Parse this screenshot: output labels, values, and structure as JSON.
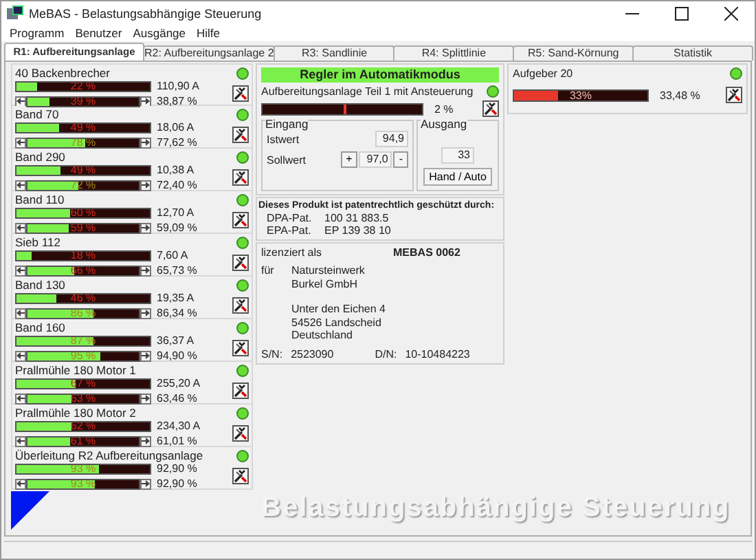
{
  "window": {
    "title": "MeBAS - Belastungsabhängige Steuerung"
  },
  "menu": [
    "Programm",
    "Benutzer",
    "Ausgänge",
    "Hilfe"
  ],
  "tabs": [
    {
      "label": "R1: Aufbereitungsanlage",
      "selected": true
    },
    {
      "label": "R2: Aufbereitungsanlage 2",
      "selected": false
    },
    {
      "label": "R3: Sandlinie",
      "selected": false
    },
    {
      "label": "R4: Splittlinie",
      "selected": false
    },
    {
      "label": "R5: Sand-Körnung",
      "selected": false
    },
    {
      "label": "Statistik",
      "selected": false
    }
  ],
  "drives": [
    {
      "name": "40 Backenbrecher",
      "color": "#66dd33",
      "load": {
        "label": "22 %",
        "level": 0.15,
        "reading": "110,90 A"
      },
      "setpoint": {
        "label": "39 %",
        "level": 0.2,
        "reading": "38,87 %"
      }
    },
    {
      "name": "Band 70",
      "color": "#66dd33",
      "load": {
        "label": "49 %",
        "level": 0.32,
        "reading": "18,06 A"
      },
      "setpoint": {
        "label": "78 %",
        "level": 0.52,
        "reading": "77,62 %"
      }
    },
    {
      "name": "Band 290",
      "color": "#66dd33",
      "load": {
        "label": "49 %",
        "level": 0.33,
        "reading": "10,38 A"
      },
      "setpoint": {
        "label": "72 %",
        "level": 0.46,
        "reading": "72,40 %"
      }
    },
    {
      "name": "Band 110",
      "color": "#66dd33",
      "load": {
        "label": "60 %",
        "level": 0.4,
        "reading": "12,70 A"
      },
      "setpoint": {
        "label": "59 %",
        "level": 0.37,
        "reading": "59,09 %"
      }
    },
    {
      "name": "Sieb 112",
      "color": "#66dd33",
      "load": {
        "label": "18 %",
        "level": 0.11,
        "reading": "7,60 A"
      },
      "setpoint": {
        "label": "66 %",
        "level": 0.42,
        "reading": "65,73 %"
      }
    },
    {
      "name": "Band 130",
      "color": "#66dd33",
      "load": {
        "label": "46 %",
        "level": 0.3,
        "reading": "19,35 A"
      },
      "setpoint": {
        "label": "86 %",
        "level": 0.59,
        "reading": "86,34 %"
      }
    },
    {
      "name": "Band 160",
      "color": "#66dd33",
      "load": {
        "label": "87 %",
        "level": 0.58,
        "reading": "36,37 A"
      },
      "setpoint": {
        "label": "95 %",
        "level": 0.66,
        "reading": "94,90 %"
      }
    },
    {
      "name": "Prallmühle 180 Motor 1",
      "color": "#66dd33",
      "load": {
        "label": "67 %",
        "level": 0.44,
        "reading": "255,20 A"
      },
      "setpoint": {
        "label": "63 %",
        "level": 0.4,
        "reading": "63,46 %"
      }
    },
    {
      "name": "Prallmühle 180 Motor 2",
      "color": "#66dd33",
      "load": {
        "label": "62 %",
        "level": 0.41,
        "reading": "234,30 A"
      },
      "setpoint": {
        "label": "61 %",
        "level": 0.38,
        "reading": "61,01 %"
      }
    },
    {
      "name": "Überleitung R2 Aufbereitungsanlage",
      "color": "#66dd33",
      "load": {
        "label": "93 %",
        "level": 0.62,
        "reading": "92,90 %"
      },
      "setpoint": {
        "label": "93 %",
        "level": 0.6,
        "reading": "92,90 %"
      }
    }
  ],
  "controller": {
    "mode_banner": "Regler im Automatikmodus",
    "name": "Aufbereitungsanlage Teil 1 mit Ansteuerung",
    "color": "#66dd33",
    "output": {
      "level": 0.51,
      "reading": "2 %"
    },
    "input": {
      "legend": "Eingang",
      "actual_label": "Istwert",
      "actual_value": "94,9",
      "setpoint_label": "Sollwert",
      "increase": "+",
      "setpoint_value": "97,0",
      "decrease": "-"
    },
    "output_group": {
      "legend": "Ausgang",
      "value": "33",
      "button": "Hand / Auto"
    }
  },
  "patent": {
    "heading": "Dieses Produkt ist patentrechtlich geschützt durch:",
    "entries": [
      {
        "label": "DPA-Pat.",
        "number": "100 31 883.5"
      },
      {
        "label": "EPA-Pat.",
        "number": "EP 139 38 10"
      }
    ]
  },
  "license": {
    "label": "lizenziert als",
    "code": "MEBAS 0062",
    "for_label": "für",
    "address_blocks": [
      [
        "Natursteinwerk",
        "Burkel GmbH"
      ],
      [
        "Unter den Eichen 4",
        "54526 Landscheid",
        "Deutschland"
      ]
    ],
    "sn_label": "S/N:",
    "sn": "2523090",
    "dn_label": "D/N:",
    "dn": "10-10484223"
  },
  "feeder": {
    "name": "Aufgeber 20",
    "color": "#66dd33",
    "label": "33%",
    "level": 0.33,
    "reading": "33,48 %"
  },
  "logo_text": "Belastungsabhängige Steuerung"
}
